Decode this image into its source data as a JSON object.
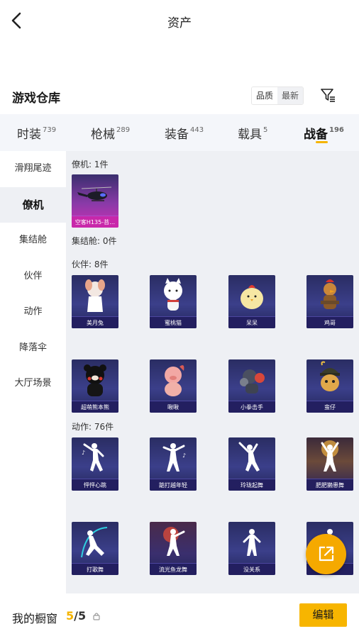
{
  "header": {
    "title": "资产"
  },
  "warehouse": {
    "title": "游戏仓库",
    "sort": [
      "品质",
      "最新"
    ]
  },
  "tabs": [
    {
      "label": "时装",
      "count": "739"
    },
    {
      "label": "枪械",
      "count": "289"
    },
    {
      "label": "装备",
      "count": "443"
    },
    {
      "label": "载具",
      "count": "5"
    },
    {
      "label": "战备",
      "count": "196"
    }
  ],
  "sidebar": [
    "滑翔尾迹",
    "僚机",
    "集结舱",
    "伙伴",
    "动作",
    "降落伞",
    "大厅场景"
  ],
  "sections": {
    "liaoji": {
      "label": "僚机: 1件",
      "items": [
        "空客H135-苔…"
      ]
    },
    "jijiecang": {
      "label": "集结舱: 0件"
    },
    "huoban": {
      "label": "伙伴: 8件",
      "items": [
        "美月兔",
        "蜜桃猫",
        "呆呆",
        "鸡哥",
        "超萌熊本熊",
        "啾啾",
        "小拳击手",
        "蛮仔"
      ]
    },
    "dongzuo": {
      "label": "动作: 76件",
      "items": [
        "怦怦心跳",
        "踮打越年轻",
        "玲珑起舞",
        "肥肥獭患舞",
        "打歌舞",
        "流光鱼龙舞",
        "没关系",
        ""
      ]
    }
  },
  "bottom": {
    "label": "我的橱窗",
    "current": "5",
    "total": "/5",
    "edit": "编辑"
  },
  "colors": {
    "accent": "#f5b400",
    "card": "#2f3270",
    "card_rare": "#cf2fb3"
  },
  "icons": [
    "back-arrow-icon",
    "filter-icon",
    "lock-icon",
    "share-export-icon"
  ]
}
